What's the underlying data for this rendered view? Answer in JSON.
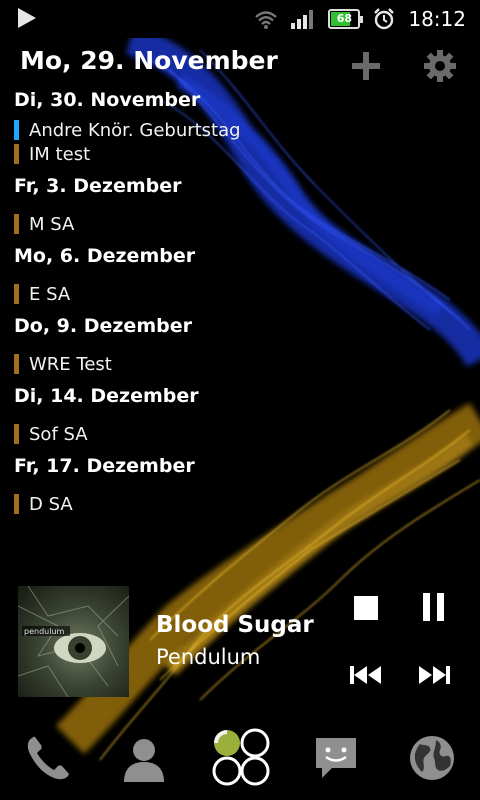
{
  "status_bar": {
    "battery_level": "68",
    "time": "18:12"
  },
  "calendar": {
    "header": "Mo, 29. November",
    "groups": [
      {
        "day": "Di, 30. November",
        "events": [
          {
            "label": "Andre Knör. Geburtstag",
            "color": "#1ea7ff"
          },
          {
            "label": "IM test",
            "color": "#a0701e"
          }
        ]
      },
      {
        "day": "Fr, 3. Dezember",
        "events": [
          {
            "label": "M SA",
            "color": "#a0701e"
          }
        ]
      },
      {
        "day": "Mo, 6. Dezember",
        "events": [
          {
            "label": "E SA",
            "color": "#a0701e"
          }
        ]
      },
      {
        "day": "Do, 9. Dezember",
        "events": [
          {
            "label": "WRE Test",
            "color": "#a0701e"
          }
        ]
      },
      {
        "day": "Di, 14. Dezember",
        "events": [
          {
            "label": "Sof SA",
            "color": "#a0701e"
          }
        ]
      },
      {
        "day": "Fr, 17. Dezember",
        "events": [
          {
            "label": "D SA",
            "color": "#a0701e"
          }
        ]
      }
    ]
  },
  "music": {
    "title": "Blood Sugar",
    "artist": "Pendulum",
    "album_text": "pendulum"
  },
  "dock": {
    "items": [
      "phone-icon",
      "contacts-icon",
      "all-apps-icon",
      "messages-icon",
      "browser-icon"
    ]
  }
}
